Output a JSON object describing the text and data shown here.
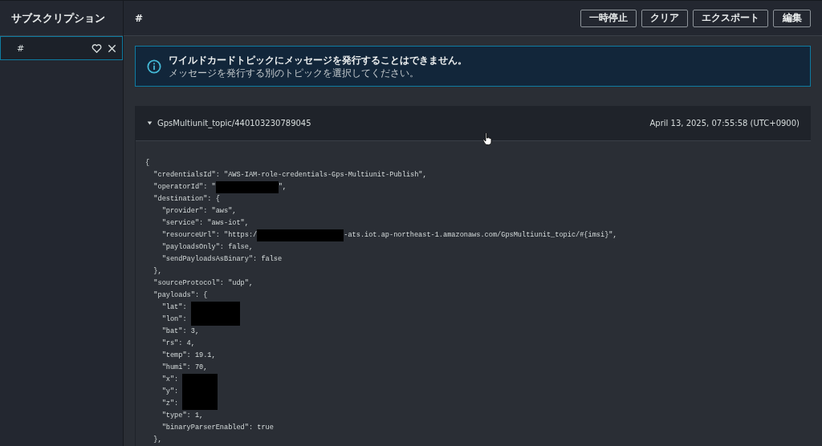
{
  "sidebar": {
    "title": "サブスクリプション",
    "items": [
      {
        "label": "#",
        "selected": true
      }
    ]
  },
  "header": {
    "topic": "#",
    "buttons": [
      "一時停止",
      "クリア",
      "エクスポート",
      "編集"
    ]
  },
  "alert": {
    "title": "ワイルドカードトピックにメッセージを発行することはできません。",
    "text": "メッセージを発行する別のトピックを選択してください。"
  },
  "message": {
    "expanded": true,
    "topic": "GpsMultiunit_topic/440103230789045",
    "time": "April 13, 2025, 07:55:58 (UTC+0900)",
    "lines": [
      [
        {
          "kind": "text",
          "text": "{"
        }
      ],
      [
        {
          "kind": "text",
          "text": "  \"credentialsId\": \"AWS-IAM-role-credentials-Gps-Multiunit-Publish\","
        }
      ],
      [
        {
          "kind": "text",
          "text": "  \"operatorId\": \""
        },
        {
          "kind": "redacted"
        },
        {
          "kind": "text",
          "text": "\","
        }
      ],
      [
        {
          "kind": "text",
          "text": "  \"destination\": {"
        }
      ],
      [
        {
          "kind": "text",
          "text": "    \"provider\": \"aws\","
        }
      ],
      [
        {
          "kind": "text",
          "text": "    \"service\": \"aws-iot\","
        }
      ],
      [
        {
          "kind": "text",
          "text": "    \"resourceUrl\": \"https:/"
        },
        {
          "kind": "redacted"
        },
        {
          "kind": "text",
          "text": "-ats.iot.ap-northeast-1.amazonaws.com/GpsMultiunit_topic/#{imsi}\","
        }
      ],
      [
        {
          "kind": "text",
          "text": "    \"payloadsOnly\": false,"
        }
      ],
      [
        {
          "kind": "text",
          "text": "    \"sendPayloadsAsBinary\": false"
        }
      ],
      [
        {
          "kind": "text",
          "text": "  },"
        }
      ],
      [
        {
          "kind": "text",
          "text": "  \"sourceProtocol\": \"udp\","
        }
      ],
      [
        {
          "kind": "text",
          "text": "  \"payloads\": {"
        }
      ],
      [
        {
          "kind": "text",
          "text": "    \"lat\": "
        },
        {
          "kind": "redacted"
        }
      ],
      [
        {
          "kind": "text",
          "text": "    \"lon\": "
        },
        {
          "kind": "redacted"
        }
      ],
      [
        {
          "kind": "text",
          "text": "    \"bat\": 3,"
        }
      ],
      [
        {
          "kind": "text",
          "text": "    \"rs\": 4,"
        }
      ],
      [
        {
          "kind": "text",
          "text": "    \"temp\": 19.1,"
        }
      ],
      [
        {
          "kind": "text",
          "text": "    \"humi\": 70,"
        }
      ],
      [
        {
          "kind": "text",
          "text": "    \"x\": "
        },
        {
          "kind": "redacted"
        }
      ],
      [
        {
          "kind": "text",
          "text": "    \"y\": "
        },
        {
          "kind": "redacted"
        }
      ],
      [
        {
          "kind": "text",
          "text": "    \"z\": "
        },
        {
          "kind": "redacted"
        }
      ],
      [
        {
          "kind": "text",
          "text": "    \"type\": 1,"
        }
      ],
      [
        {
          "kind": "text",
          "text": "    \"binaryParserEnabled\": true"
        }
      ],
      [
        {
          "kind": "text",
          "text": "  },"
        }
      ]
    ]
  }
}
